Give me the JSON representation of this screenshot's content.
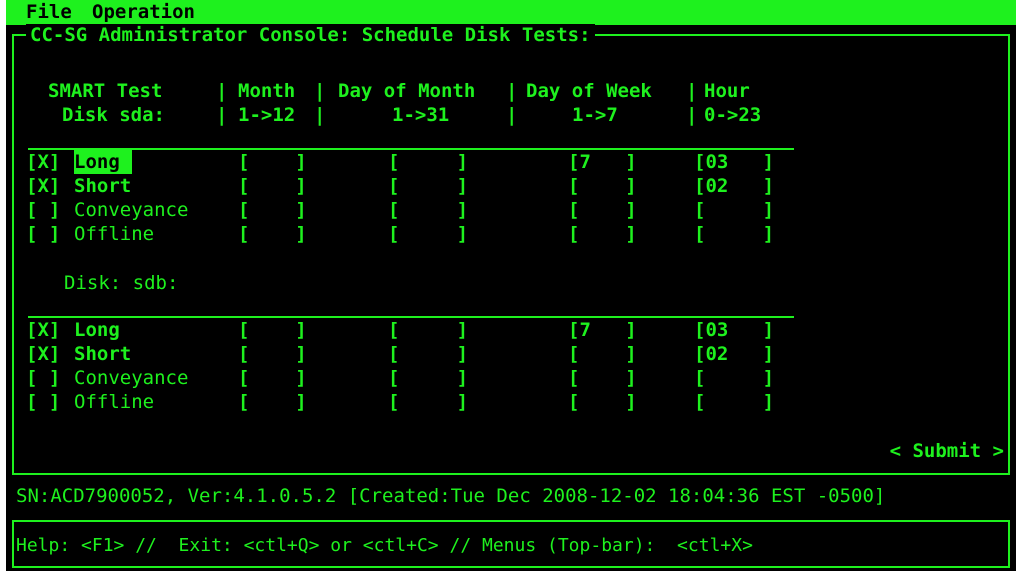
{
  "menu": {
    "file": "File",
    "operation": "Operation"
  },
  "title": "CC-SG Administrator Console: Schedule Disk Tests:",
  "header": {
    "col1_top": "SMART Test",
    "col1_bottom": "Disk sda:",
    "month_top": "Month",
    "month_bottom": "1->12",
    "dom_top": "Day of Month",
    "dom_bottom": "1->31",
    "dow_top": "Day of Week",
    "dow_bottom": "1->7",
    "hour_top": "Hour",
    "hour_bottom": "0->23",
    "sep": "|"
  },
  "disk2_label": "Disk: sdb:",
  "disks": [
    {
      "rows": [
        {
          "check": "[X]",
          "label": "Long",
          "month": "[    ]",
          "dom": "[     ]",
          "dow": "[7   ]",
          "hour": "[03   ]"
        },
        {
          "check": "[X]",
          "label": "Short",
          "month": "[    ]",
          "dom": "[     ]",
          "dow": "[    ]",
          "hour": "[02   ]"
        },
        {
          "check": "[ ]",
          "label": "Conveyance",
          "month": "[    ]",
          "dom": "[     ]",
          "dow": "[    ]",
          "hour": "[     ]"
        },
        {
          "check": "[ ]",
          "label": "Offline",
          "month": "[    ]",
          "dom": "[     ]",
          "dow": "[    ]",
          "hour": "[     ]"
        }
      ]
    },
    {
      "rows": [
        {
          "check": "[X]",
          "label": "Long",
          "month": "[    ]",
          "dom": "[     ]",
          "dow": "[7   ]",
          "hour": "[03   ]"
        },
        {
          "check": "[X]",
          "label": "Short",
          "month": "[    ]",
          "dom": "[     ]",
          "dow": "[    ]",
          "hour": "[02   ]"
        },
        {
          "check": "[ ]",
          "label": "Conveyance",
          "month": "[    ]",
          "dom": "[     ]",
          "dow": "[    ]",
          "hour": "[     ]"
        },
        {
          "check": "[ ]",
          "label": "Offline",
          "month": "[    ]",
          "dom": "[     ]",
          "dow": "[    ]",
          "hour": "[     ]"
        }
      ]
    }
  ],
  "submit": "< Submit >",
  "status_line": "SN:ACD7900052, Ver:4.1.0.5.2 [Created:Tue Dec 2008-12-02 18:04:36 EST -0500]",
  "help_line": "Help: <F1> //  Exit: <ctl+Q> or <ctl+C> // Menus (Top-bar):  <ctl+X>",
  "colors": {
    "fg": "#1ef11e",
    "bg": "#000000"
  }
}
